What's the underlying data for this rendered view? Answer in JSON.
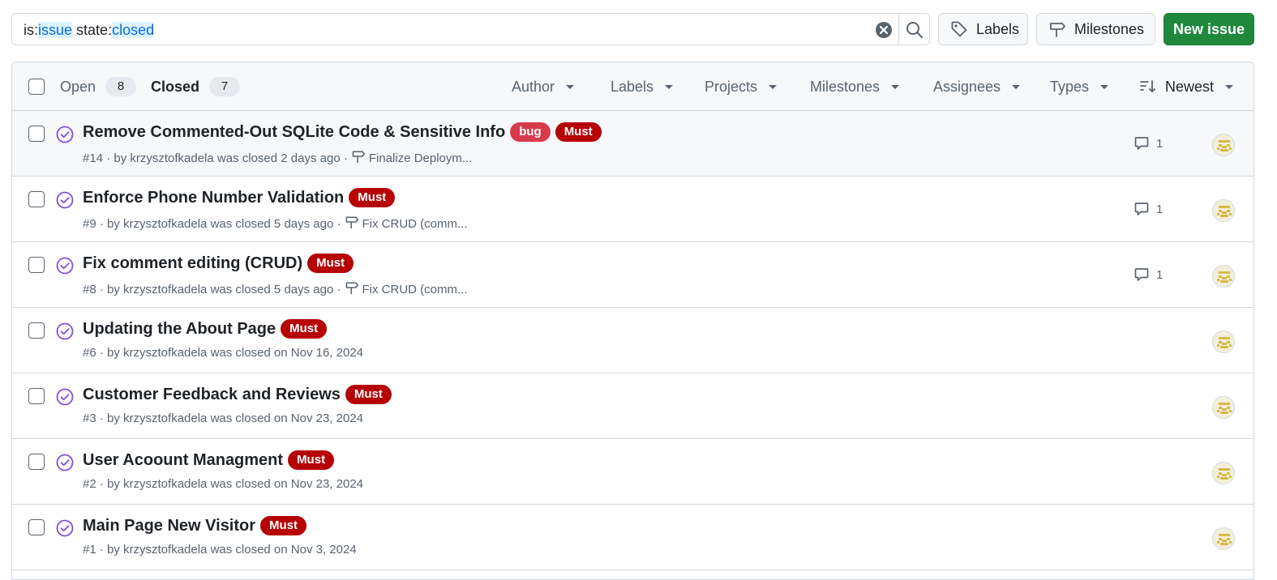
{
  "search": {
    "tokens": [
      {
        "key": "is:",
        "value": "issue"
      },
      {
        "key": "state:",
        "value": "closed"
      }
    ]
  },
  "toolbar": {
    "labels_button": "Labels",
    "milestones_button": "Milestones",
    "new_issue_button": "New issue"
  },
  "header": {
    "open_label": "Open",
    "open_count": "8",
    "closed_label": "Closed",
    "closed_count": "7",
    "filters": {
      "author": "Author",
      "labels": "Labels",
      "projects": "Projects",
      "milestones": "Milestones",
      "assignees": "Assignees",
      "types": "Types",
      "sort": "Newest"
    }
  },
  "colors": {
    "accent": "#0969da",
    "closed_purple": "#8250df",
    "bug_label": "#d73a4a",
    "must_label": "#b60205",
    "new_issue_green": "#1f883d"
  },
  "issues": [
    {
      "title": "Remove Commented-Out SQLite Code & Sensitive Info",
      "labels": [
        {
          "name": "bug",
          "color": "#d73a4a"
        },
        {
          "name": "Must",
          "color": "#b60205"
        }
      ],
      "meta": "#14 · by krzysztofkadela was closed 2 days ago ·",
      "milestone": "Finalize Deploym...",
      "comments": "1"
    },
    {
      "title": "Enforce Phone Number Validation",
      "labels": [
        {
          "name": "Must",
          "color": "#b60205"
        }
      ],
      "meta": "#9 · by krzysztofkadela was closed 5 days ago ·",
      "milestone": "Fix CRUD (comm...",
      "comments": "1"
    },
    {
      "title": "Fix comment editing (CRUD)",
      "labels": [
        {
          "name": "Must",
          "color": "#b60205"
        }
      ],
      "meta": "#8 · by krzysztofkadela was closed 5 days ago ·",
      "milestone": "Fix CRUD (comm...",
      "comments": "1"
    },
    {
      "title": "Updating the About Page",
      "labels": [
        {
          "name": "Must",
          "color": "#b60205"
        }
      ],
      "meta": "#6 · by krzysztofkadela was closed on Nov 16, 2024",
      "milestone": "",
      "comments": ""
    },
    {
      "title": "Customer Feedback and Reviews",
      "labels": [
        {
          "name": "Must",
          "color": "#b60205"
        }
      ],
      "meta": "#3 · by krzysztofkadela was closed on Nov 23, 2024",
      "milestone": "",
      "comments": ""
    },
    {
      "title": "User Acoount Managment",
      "labels": [
        {
          "name": "Must",
          "color": "#b60205"
        }
      ],
      "meta": "#2 · by krzysztofkadela was closed on Nov 23, 2024",
      "milestone": "",
      "comments": ""
    },
    {
      "title": "Main Page New Visitor",
      "labels": [
        {
          "name": "Must",
          "color": "#b60205"
        }
      ],
      "meta": "#1 · by krzysztofkadela was closed on Nov 3, 2024",
      "milestone": "",
      "comments": ""
    }
  ]
}
